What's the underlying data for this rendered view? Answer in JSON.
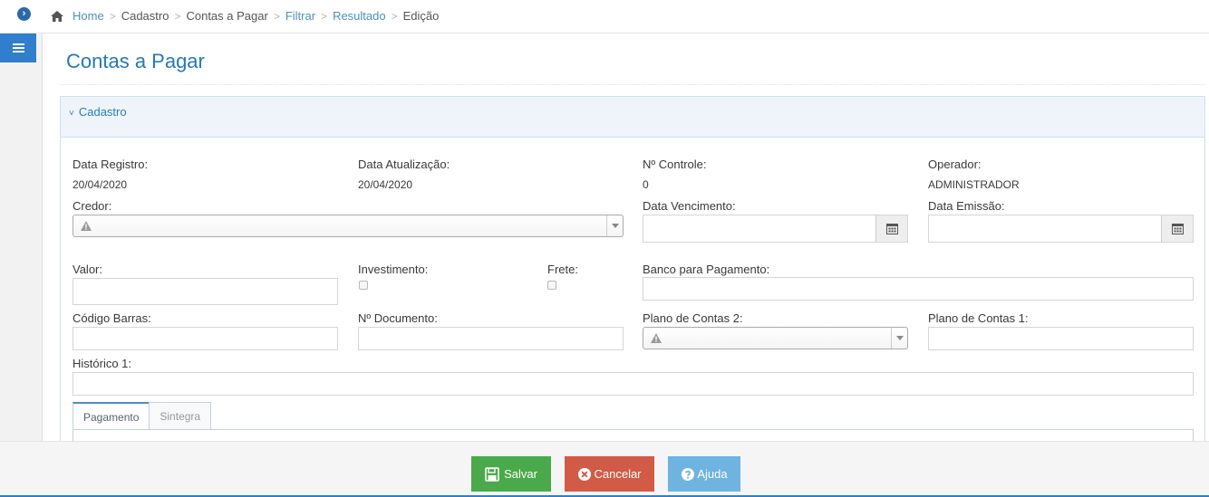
{
  "breadcrumb": {
    "items": [
      {
        "label": "Home",
        "link": true
      },
      {
        "label": "Cadastro",
        "link": false
      },
      {
        "label": "Contas a Pagar",
        "link": false
      },
      {
        "label": "Filtrar",
        "link": true
      },
      {
        "label": "Resultado",
        "link": true
      },
      {
        "label": "Edição",
        "link": false
      }
    ],
    "separator": ">"
  },
  "page": {
    "title": "Contas a Pagar"
  },
  "panel": {
    "title": "Cadastro",
    "chevron": "˅"
  },
  "info": {
    "data_registro": {
      "label": "Data Registro:",
      "value": "20/04/2020"
    },
    "data_atualizacao": {
      "label": "Data Atualização:",
      "value": "20/04/2020"
    },
    "n_controle": {
      "label": "Nº Controle:",
      "value": "0"
    },
    "operador": {
      "label": "Operador:",
      "value": "ADMINISTRADOR"
    }
  },
  "form": {
    "credor": {
      "label": "Credor:",
      "value": ""
    },
    "data_vencimento": {
      "label": "Data Vencimento:",
      "value": ""
    },
    "data_emissao": {
      "label": "Data Emissão:",
      "value": ""
    },
    "valor": {
      "label": "Valor:",
      "value": ""
    },
    "investimento": {
      "label": "Investimento:",
      "checked": false
    },
    "frete": {
      "label": "Frete:",
      "checked": false
    },
    "banco_pagamento": {
      "label": "Banco para Pagamento:",
      "value": ""
    },
    "codigo_barras": {
      "label": "Código Barras:",
      "value": ""
    },
    "n_documento": {
      "label": "Nº Documento:",
      "value": ""
    },
    "plano_contas_2": {
      "label": "Plano de Contas 2:",
      "value": ""
    },
    "plano_contas_1": {
      "label": "Plano de Contas 1:",
      "value": ""
    },
    "historico_1": {
      "label": "Histórico 1:",
      "value": ""
    }
  },
  "tabs": [
    {
      "label": "Pagamento",
      "active": true
    },
    {
      "label": "Sintegra",
      "active": false
    }
  ],
  "footer": {
    "save_label": "Salvar",
    "cancel_label": "Cancelar",
    "help_label": "Ajuda"
  },
  "icons": {
    "collapse": "chevron-right-circle-icon",
    "menu": "hamburger-icon",
    "home": "home-icon",
    "calendar": "calendar-icon",
    "warning": "warning-icon",
    "save": "floppy-icon",
    "cancel": "times-circle-icon",
    "help": "question-circle-icon"
  },
  "colors": {
    "accent": "#2679b5",
    "save": "#4aa94a",
    "cancel": "#d15b47",
    "help": "#6fb3e0",
    "sidebar_button": "#307ecc"
  }
}
